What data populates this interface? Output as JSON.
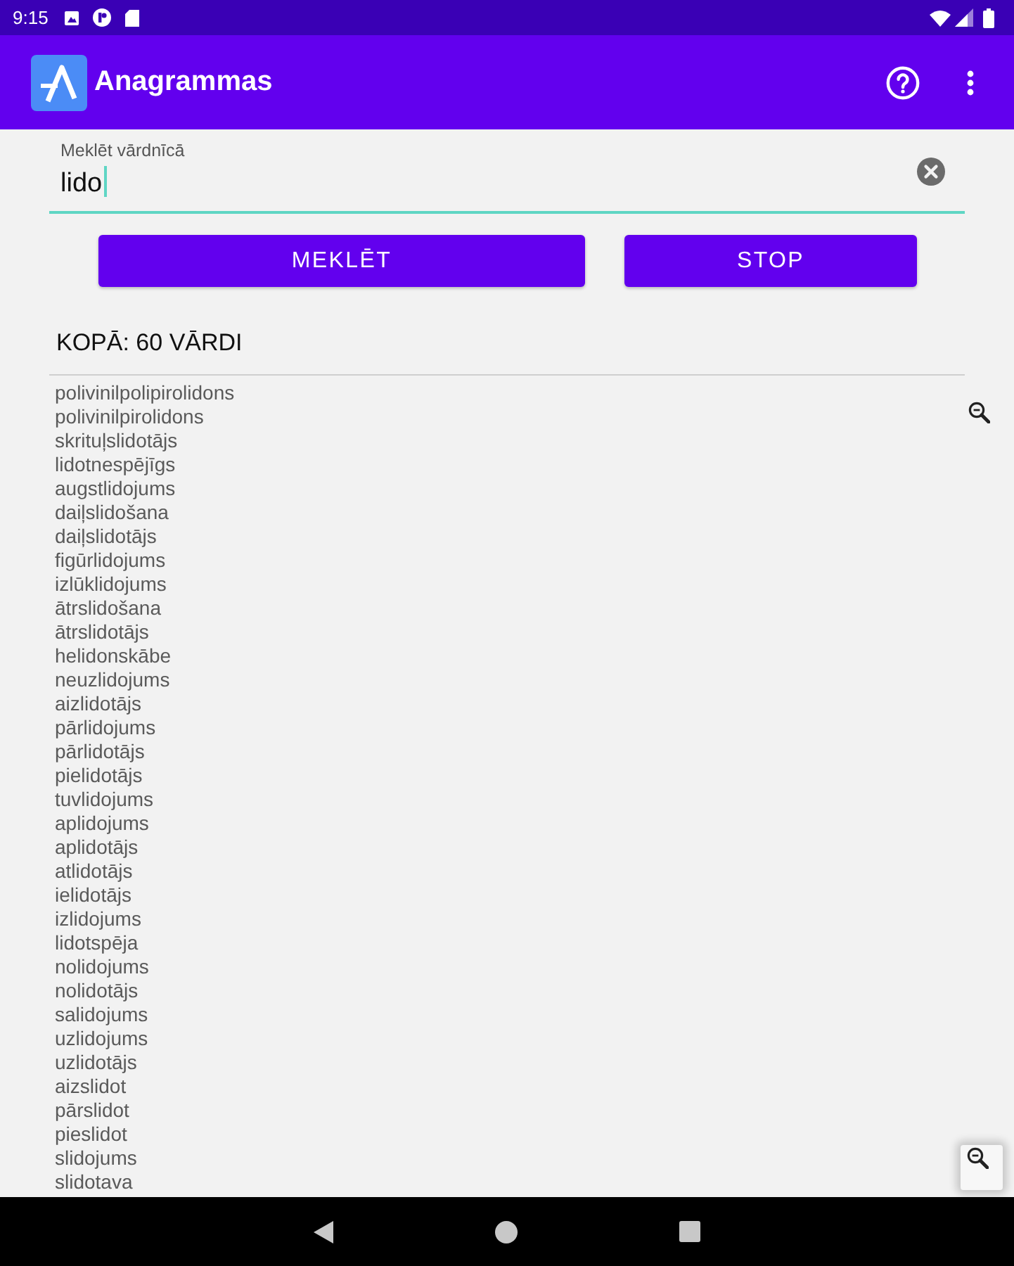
{
  "status_bar": {
    "time": "9:15"
  },
  "app_bar": {
    "title": "Anagrammas"
  },
  "search": {
    "label": "Meklēt vārdnīcā",
    "value": "lido",
    "focused": true
  },
  "buttons": [
    {
      "label": "MEKLĒT"
    },
    {
      "label": "STOP"
    }
  ],
  "summary": "KOPĀ: 60 VĀRDI",
  "results": [
    "polivinilpolipirolidons",
    "polivinilpirolidons",
    "skrituļslidotājs",
    "lidotnespējīgs",
    "augstlidojums",
    "daiļslidošana",
    "daiļslidotājs",
    "figūrlidojums",
    "izlūklidojums",
    "ātrslidošana",
    "ātrslidotājs",
    "helidonskābe",
    "neuzlidojums",
    "aizlidotājs",
    "pārlidojums",
    "pārlidotājs",
    "pielidotājs",
    "tuvlidojums",
    "aplidojums",
    "aplidotājs",
    "atlidotājs",
    "ielidotājs",
    "izlidojums",
    "lidotspēja",
    "nolidojums",
    "nolidotājs",
    "salidojums",
    "uzlidojums",
    "uzlidotājs",
    "aizslidot",
    "pārslidot",
    "pieslidot",
    "slidojums",
    "slidotava"
  ]
}
